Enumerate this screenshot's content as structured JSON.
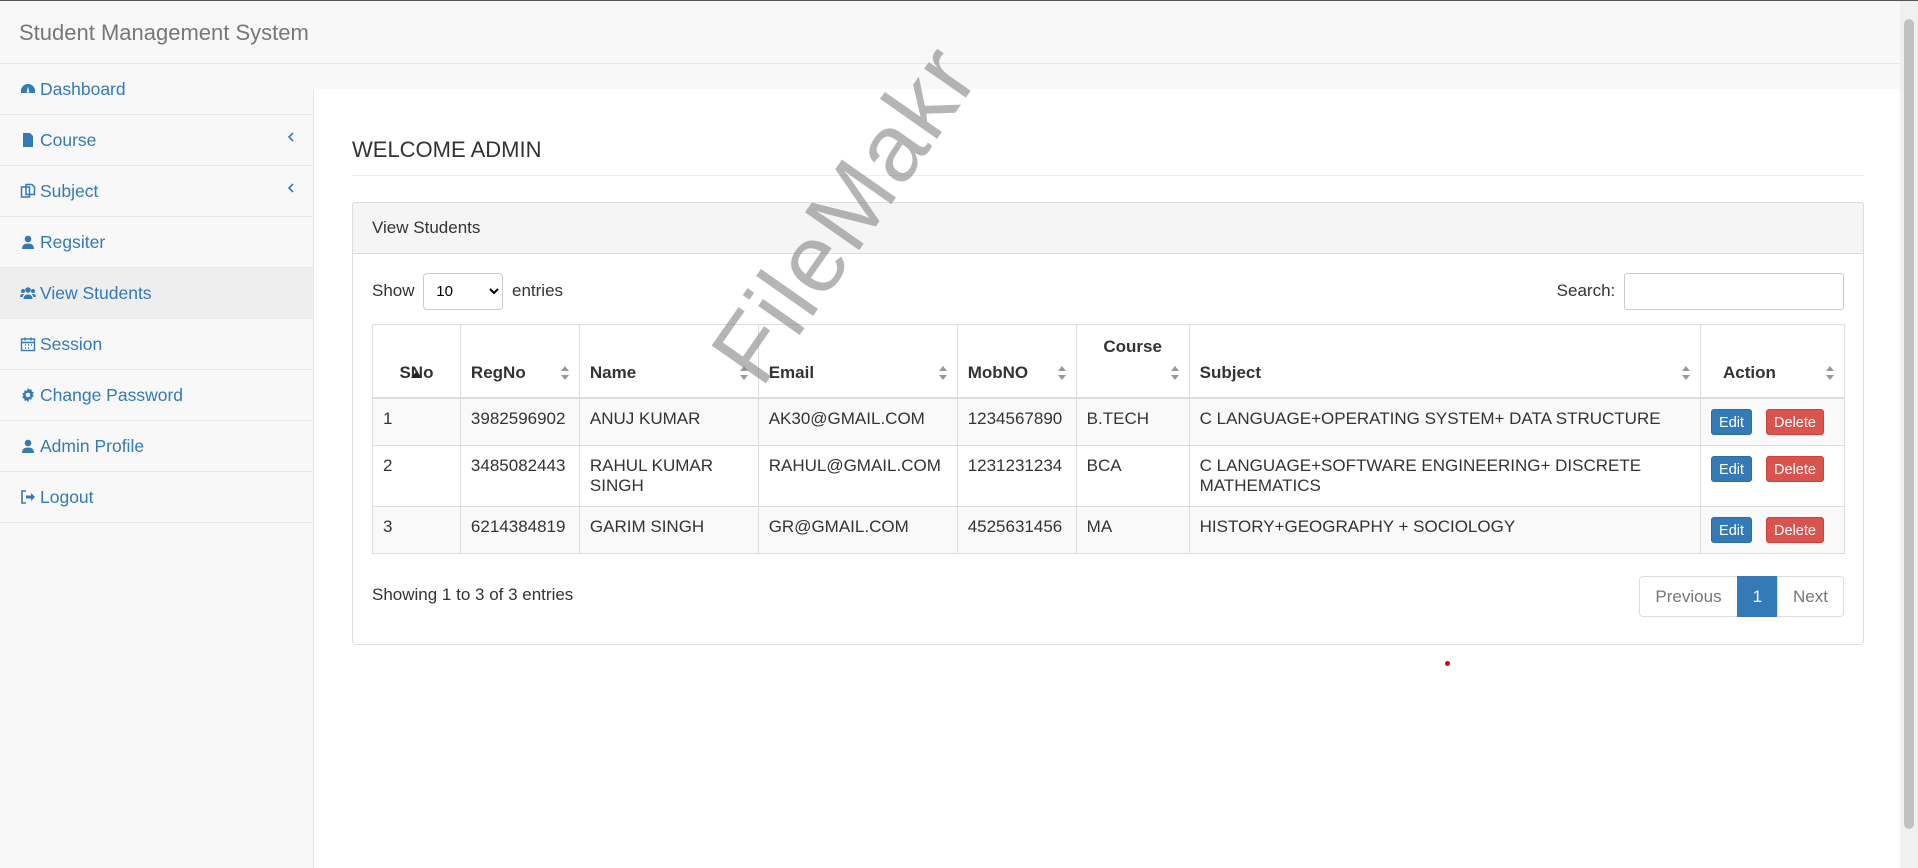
{
  "navbar": {
    "brand": "Student Management System"
  },
  "sidebar": {
    "items": [
      {
        "label": "Dashboard",
        "icon": "dashboard-icon"
      },
      {
        "label": "Course",
        "icon": "file-icon"
      },
      {
        "label": "Subject",
        "icon": "copy-icon"
      },
      {
        "label": "Regsiter",
        "icon": "user-icon"
      },
      {
        "label": "View Students",
        "icon": "users-icon"
      },
      {
        "label": "Session",
        "icon": "calendar-icon"
      },
      {
        "label": "Change Password",
        "icon": "gear-icon"
      },
      {
        "label": "Admin Profile",
        "icon": "user-icon"
      },
      {
        "label": "Logout",
        "icon": "sign-out-icon"
      }
    ]
  },
  "page": {
    "title": "WELCOME ADMIN",
    "panel_title": "View Students",
    "show_label": "Show",
    "entries_label": "entries",
    "entries_value": "10",
    "search_label": "Search:",
    "search_value": "",
    "table": {
      "headers": [
        "SNo",
        "RegNo",
        "Name",
        "Email",
        "MobNO",
        "Course",
        "Subject",
        "Action"
      ],
      "rows": [
        {
          "sno": "1",
          "regno": "3982596902",
          "name": "ANUJ KUMAR",
          "email": "AK30@GMAIL.COM",
          "mob": "1234567890",
          "course": "B.TECH",
          "subject": "C LANGUAGE+OPERATING SYSTEM+ DATA STRUCTURE"
        },
        {
          "sno": "2",
          "regno": "3485082443",
          "name": "RAHUL KUMAR SINGH",
          "email": "RAHUL@GMAIL.COM",
          "mob": "1231231234",
          "course": "BCA",
          "subject": "C LANGUAGE+SOFTWARE ENGINEERING+ DISCRETE MATHEMATICS"
        },
        {
          "sno": "3",
          "regno": "6214384819",
          "name": "GARIM SINGH",
          "email": "GR@GMAIL.COM",
          "mob": "4525631456",
          "course": "MA",
          "subject": "HISTORY+GEOGRAPHY + SOCIOLOGY"
        }
      ],
      "edit_label": "Edit",
      "delete_label": "Delete"
    },
    "info": "Showing 1 to 3 of 3 entries",
    "pager": {
      "previous": "Previous",
      "current": "1",
      "next": "Next"
    }
  },
  "watermark": "FileMakr",
  "colors": {
    "link": "#337ab7",
    "edit": "#337ab7",
    "delete": "#d9534f"
  }
}
